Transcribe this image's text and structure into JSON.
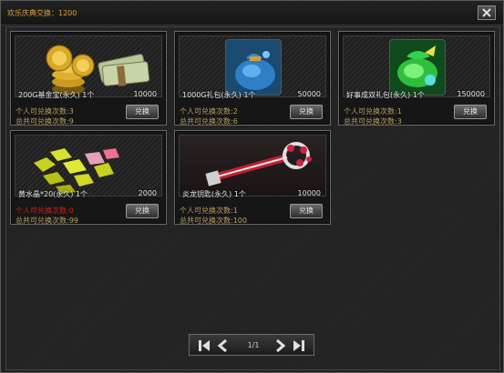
{
  "header": {
    "title": "欢乐庆典交换：1200"
  },
  "cards": [
    {
      "name": "200G基金宝(永久)  1个",
      "qty": "10000",
      "personal": "个人可兑换次数:3",
      "total": "总共可兑换次数:9",
      "button": "兑换",
      "icon": "gold-coins-icon"
    },
    {
      "name": "1000G礼包(永久)  1个",
      "qty": "50000",
      "personal": "个人可兑换次数:2",
      "total": "总共可兑换次数:6",
      "button": "兑换",
      "icon": "blue-gift-bag-icon"
    },
    {
      "name": "好事成双礼包(永久)  1个",
      "qty": "150000",
      "personal": "个人可兑换次数:1",
      "total": "总共可兑换次数:3",
      "button": "兑换",
      "icon": "green-gift-bag-icon"
    },
    {
      "name": "黄水晶*20(永久)  1个",
      "qty": "2000",
      "personal": "个人可兑换次数:0",
      "total": "总共可兑换次数:99",
      "button": "兑换",
      "icon": "yellow-crystals-icon"
    },
    {
      "name": "炎龙钥匙(永久)  1个",
      "qty": "10000",
      "personal": "个人可兑换次数:1",
      "total": "总共可兑换次数:100",
      "button": "兑换",
      "icon": "dragon-key-icon"
    }
  ],
  "pager": {
    "page_text": "1/1"
  },
  "colors": {
    "title": "#d2a23c",
    "info": "#b8a060",
    "limit_reached": "#d02020"
  }
}
